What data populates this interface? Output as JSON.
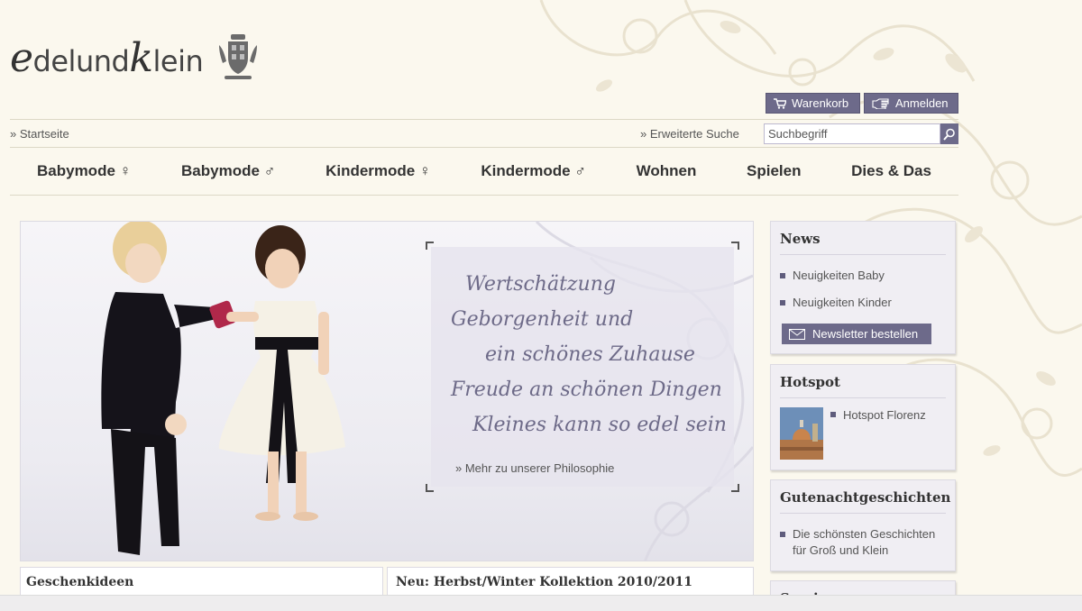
{
  "logo": {
    "script_letter_1": "e",
    "text_1": "delund",
    "script_letter_2": "k",
    "text_2": "lein"
  },
  "account": {
    "cart_label": "Warenkorb",
    "login_label": "Anmelden"
  },
  "breadcrumb": {
    "home": "» Startseite"
  },
  "search": {
    "advanced_label": "» Erweiterte Suche",
    "value": "Suchbegriff"
  },
  "nav": {
    "items": [
      {
        "label": "Babymode ♀"
      },
      {
        "label": "Babymode ♂"
      },
      {
        "label": "Kindermode ♀"
      },
      {
        "label": "Kindermode ♂"
      },
      {
        "label": "Wohnen"
      },
      {
        "label": "Spielen"
      },
      {
        "label": "Dies & Das"
      }
    ]
  },
  "hero": {
    "quote_lines": [
      "Wertschätzung",
      "Geborgenheit und",
      "ein schönes Zuhause",
      "Freude an schönen Dingen",
      "Kleines kann so edel sein"
    ],
    "more_link": "» Mehr zu unserer Philosophie"
  },
  "sidebar": {
    "news": {
      "title": "News",
      "items": [
        "Neuigkeiten Baby",
        "Neuigkeiten Kinder"
      ],
      "newsletter_label": "Newsletter bestellen"
    },
    "hotspot": {
      "title": "Hotspot",
      "items": [
        "Hotspot Florenz"
      ]
    },
    "stories": {
      "title": "Gutenachtgeschichten",
      "items": [
        "Die schönsten Geschichten für Groß und Klein"
      ]
    },
    "next": {
      "title": "Service"
    }
  },
  "panels": {
    "left_title": "Geschenkideen",
    "right_title": "Neu: Herbst/Winter Kollektion 2010/2011"
  },
  "colors": {
    "background": "#fbf8ee",
    "accent": "#6d6a8a",
    "quote_text": "#6d6a88"
  }
}
